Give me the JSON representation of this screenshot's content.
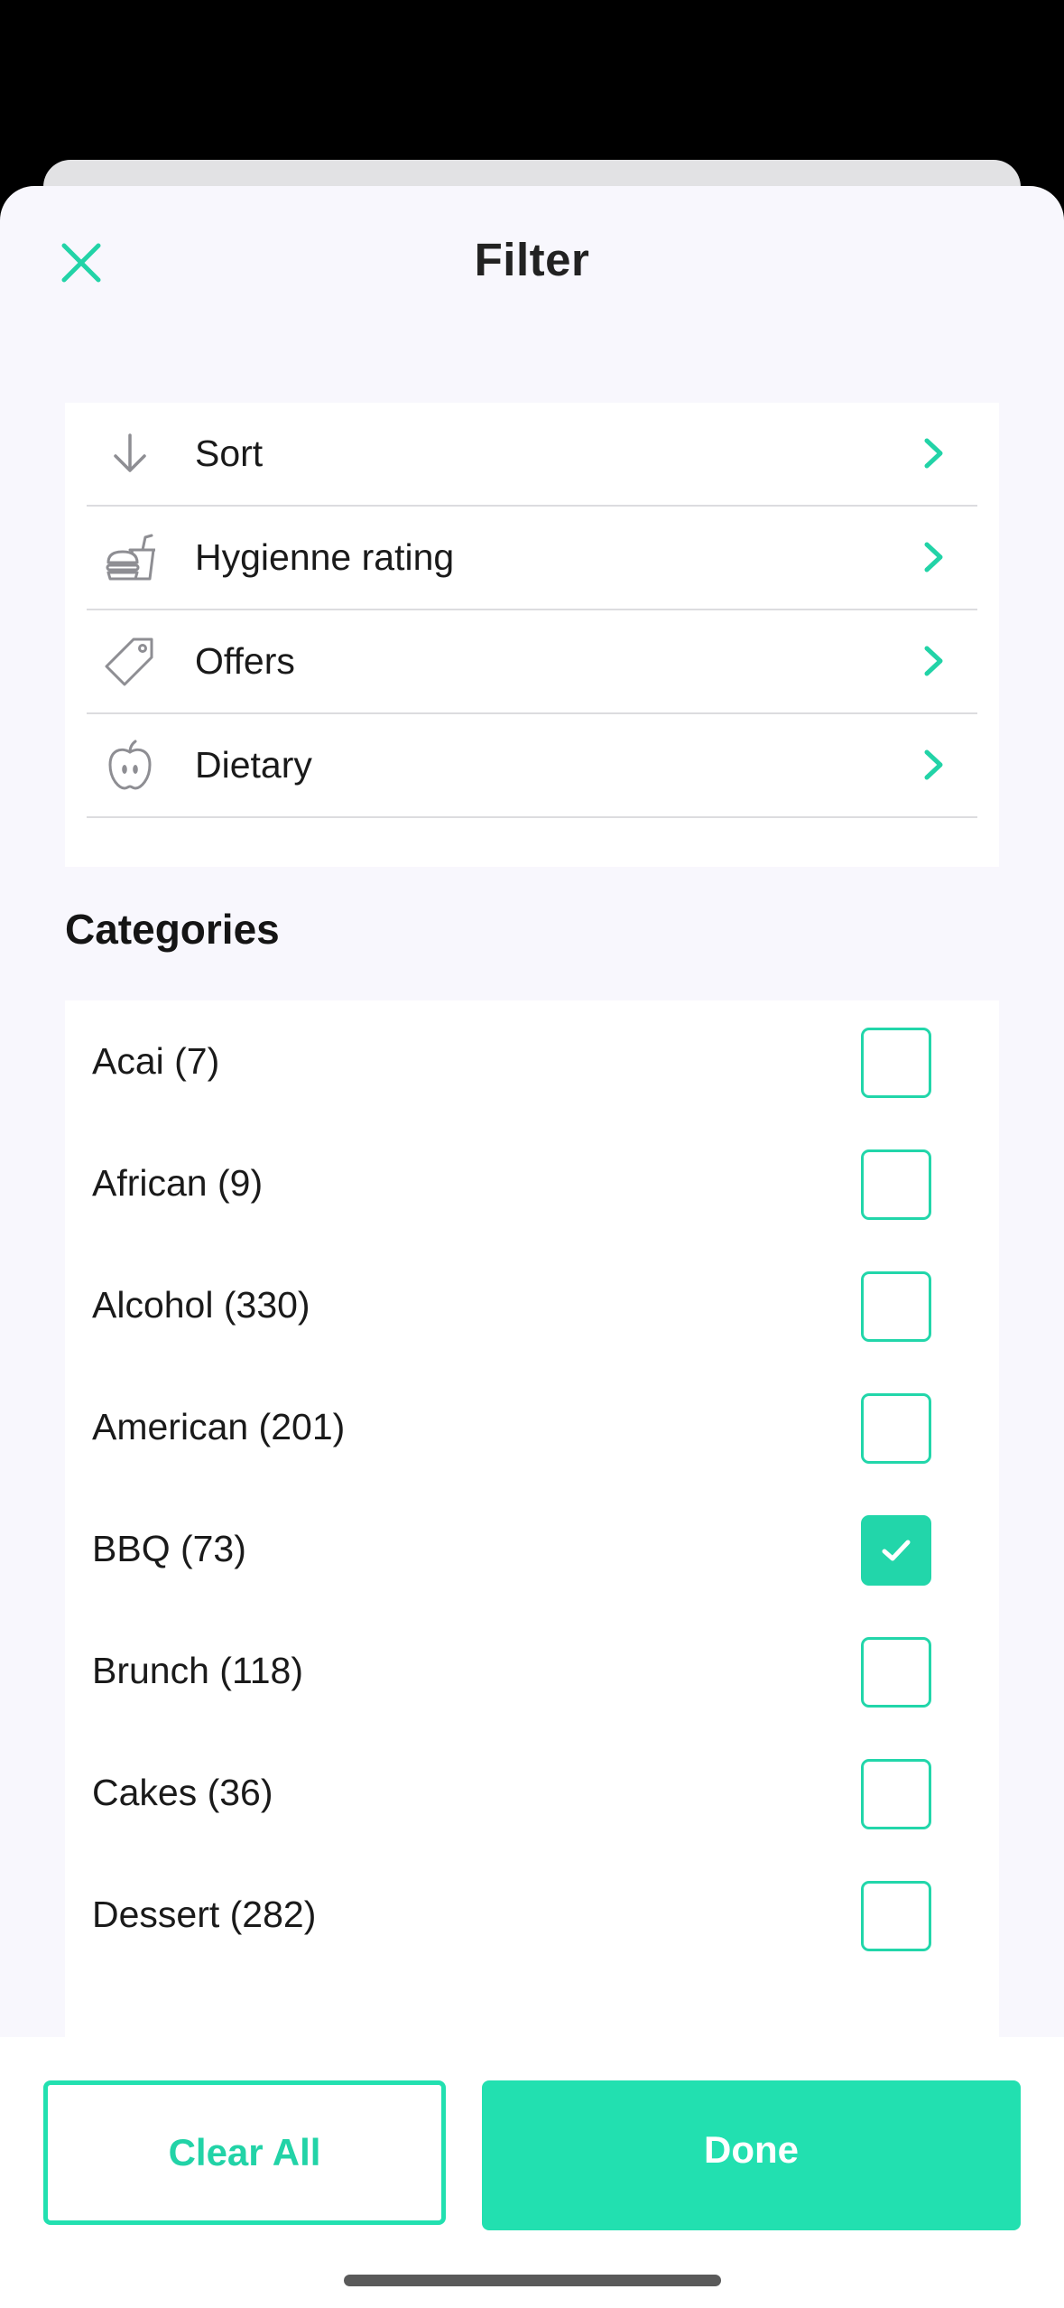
{
  "sheet": {
    "title": "Filter",
    "close_icon": "close-icon"
  },
  "options": [
    {
      "label": "Sort",
      "icon": "arrow-down-icon"
    },
    {
      "label": "Hygienne rating",
      "icon": "food-drink-icon"
    },
    {
      "label": "Offers",
      "icon": "tag-icon"
    },
    {
      "label": "Dietary",
      "icon": "apple-icon"
    }
  ],
  "categories": {
    "heading": "Categories",
    "items": [
      {
        "label": "Acai (7)",
        "checked": false
      },
      {
        "label": "African (9)",
        "checked": false
      },
      {
        "label": "Alcohol (330)",
        "checked": false
      },
      {
        "label": "American (201)",
        "checked": false
      },
      {
        "label": "BBQ (73)",
        "checked": true
      },
      {
        "label": "Brunch (118)",
        "checked": false
      },
      {
        "label": "Cakes (36)",
        "checked": false
      },
      {
        "label": "Dessert (282)",
        "checked": false
      }
    ]
  },
  "footer": {
    "clear_label": "Clear All",
    "done_label": "Done"
  },
  "colors": {
    "accent": "#22e0b0",
    "sheet_background": "#f8f7fd",
    "card_background": "#ffffff",
    "icon_gray": "#8e8e93"
  }
}
